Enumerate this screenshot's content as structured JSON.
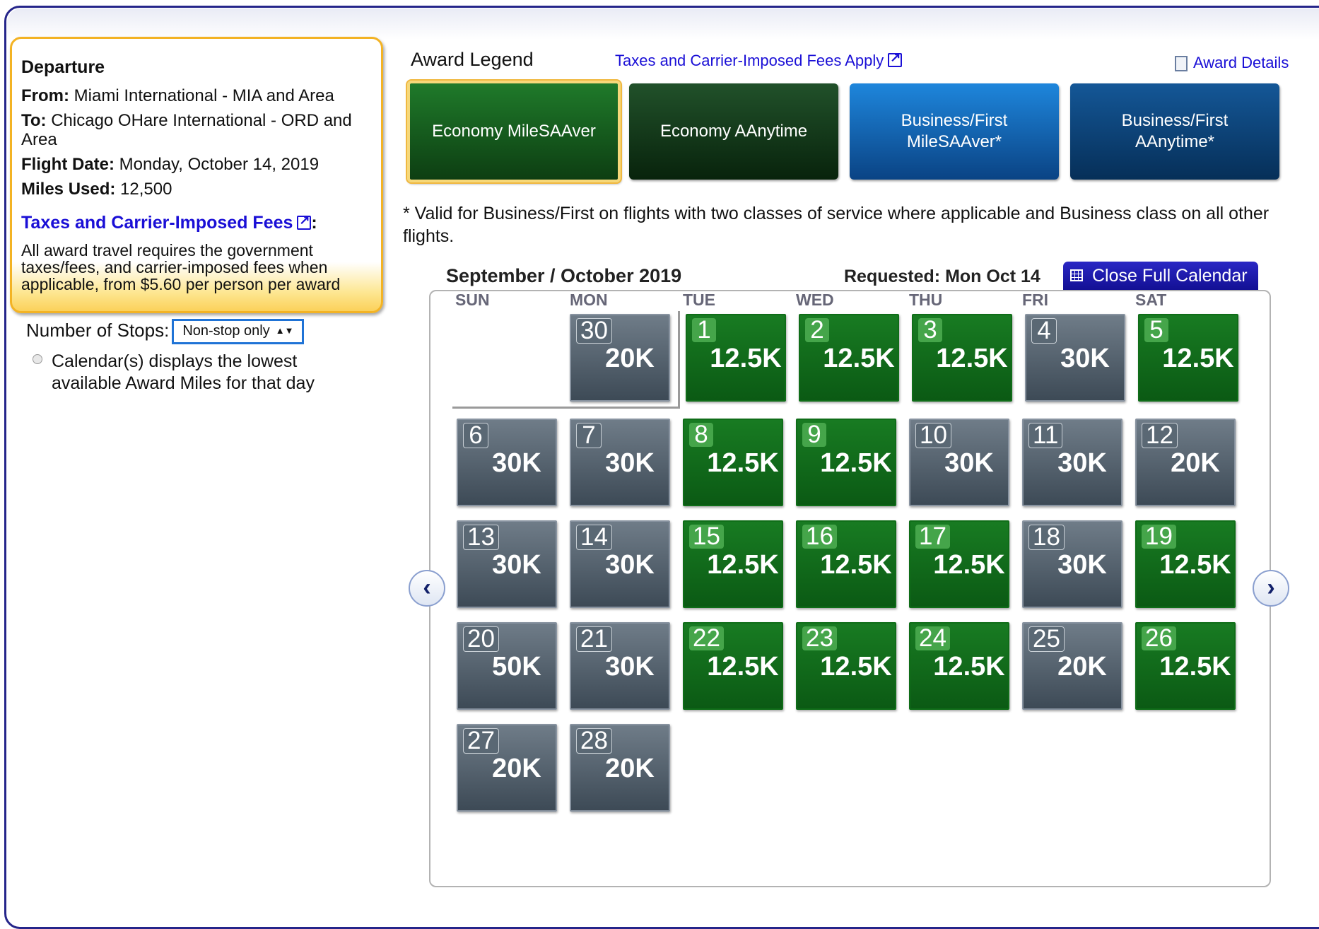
{
  "departure": {
    "title": "Departure",
    "from_label": "From:",
    "from_value": "Miami International - MIA and Area",
    "to_label": "To:",
    "to_value": "Chicago OHare International - ORD and Area",
    "date_label": "Flight Date:",
    "date_value": "Monday, October 14, 2019",
    "miles_label": "Miles Used:",
    "miles_value": "12,500",
    "fees_link": "Taxes and Carrier-Imposed Fees",
    "fees_colon": ":",
    "fees_note": "All award travel requires the government taxes/fees, and carrier-imposed fees when applicable, from $5.60 per person per award"
  },
  "stops": {
    "label": "Number of Stops:",
    "selected": "Non-stop only",
    "note": "Calendar(s) displays the lowest available Award Miles for that day"
  },
  "legend": {
    "title": "Award Legend",
    "taxes_link": "Taxes and Carrier-Imposed Fees Apply",
    "details_link": "Award Details",
    "eco_saver": "Economy MileSAAver",
    "eco_anytime": "Economy AAnytime",
    "bus_saver": "Business/First MileSAAver*",
    "bus_anytime": "Business/First AAnytime*",
    "note": "* Valid for Business/First on flights with two classes of service where applicable and Business class on all other flights."
  },
  "calendar": {
    "month": "September / October 2019",
    "requested": "Requested: Mon Oct 14",
    "close_button": "Close Full Calendar",
    "days_of_week": [
      "SUN",
      "MON",
      "TUE",
      "WED",
      "THU",
      "FRI",
      "SAT"
    ],
    "days": [
      {
        "day": "30",
        "miles": "20K",
        "type": "gray"
      },
      {
        "day": "1",
        "miles": "12.5K",
        "type": "green"
      },
      {
        "day": "2",
        "miles": "12.5K",
        "type": "green"
      },
      {
        "day": "3",
        "miles": "12.5K",
        "type": "green"
      },
      {
        "day": "4",
        "miles": "30K",
        "type": "gray"
      },
      {
        "day": "5",
        "miles": "12.5K",
        "type": "green"
      },
      {
        "day": "6",
        "miles": "30K",
        "type": "gray"
      },
      {
        "day": "7",
        "miles": "30K",
        "type": "gray"
      },
      {
        "day": "8",
        "miles": "12.5K",
        "type": "green"
      },
      {
        "day": "9",
        "miles": "12.5K",
        "type": "green"
      },
      {
        "day": "10",
        "miles": "30K",
        "type": "gray"
      },
      {
        "day": "11",
        "miles": "30K",
        "type": "gray"
      },
      {
        "day": "12",
        "miles": "20K",
        "type": "gray"
      },
      {
        "day": "13",
        "miles": "30K",
        "type": "gray"
      },
      {
        "day": "14",
        "miles": "30K",
        "type": "gray"
      },
      {
        "day": "15",
        "miles": "12.5K",
        "type": "green"
      },
      {
        "day": "16",
        "miles": "12.5K",
        "type": "green"
      },
      {
        "day": "17",
        "miles": "12.5K",
        "type": "green"
      },
      {
        "day": "18",
        "miles": "30K",
        "type": "gray"
      },
      {
        "day": "19",
        "miles": "12.5K",
        "type": "green"
      },
      {
        "day": "20",
        "miles": "50K",
        "type": "gray"
      },
      {
        "day": "21",
        "miles": "30K",
        "type": "gray"
      },
      {
        "day": "22",
        "miles": "12.5K",
        "type": "green"
      },
      {
        "day": "23",
        "miles": "12.5K",
        "type": "green"
      },
      {
        "day": "24",
        "miles": "12.5K",
        "type": "green"
      },
      {
        "day": "25",
        "miles": "20K",
        "type": "gray"
      },
      {
        "day": "26",
        "miles": "12.5K",
        "type": "green"
      },
      {
        "day": "27",
        "miles": "20K",
        "type": "gray"
      },
      {
        "day": "28",
        "miles": "20K",
        "type": "gray"
      }
    ],
    "prev_icon": "chevron-left-icon",
    "next_icon": "chevron-right-icon"
  },
  "colors": {
    "economy_saver": "#1f7a2a",
    "economy_anytime": "#21512a",
    "business_saver": "#1e86dc",
    "business_anytime": "#145797",
    "link": "#1a0fd6",
    "close_button": "#2a27c4",
    "unavailable_gray": "#5a6874"
  }
}
